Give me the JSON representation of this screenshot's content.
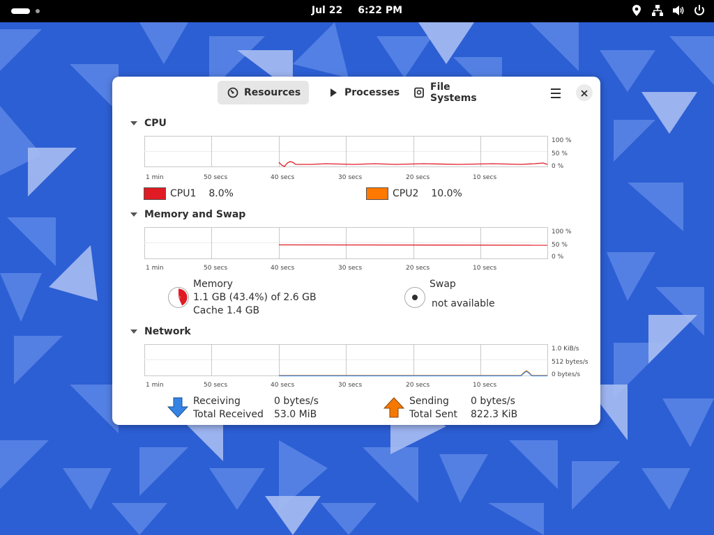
{
  "topbar": {
    "date": "Jul 22",
    "time": "6:22 PM",
    "icons": [
      "location-icon",
      "network-icon",
      "volume-icon",
      "power-icon"
    ]
  },
  "window": {
    "tabs": [
      {
        "label": "Resources",
        "icon": "gauge-icon",
        "active": true
      },
      {
        "label": "Processes",
        "icon": "play-icon",
        "active": false
      },
      {
        "label": "File Systems",
        "icon": "disk-icon",
        "active": false
      }
    ],
    "cpu": {
      "title": "CPU",
      "x_labels": [
        "1 min",
        "50 secs",
        "40 secs",
        "30 secs",
        "20 secs",
        "10 secs"
      ],
      "y_labels": [
        "100 %",
        "50 %",
        "0 %"
      ],
      "cpus": [
        {
          "name": "CPU1",
          "value": "8.0%",
          "color": "#e01b24"
        },
        {
          "name": "CPU2",
          "value": "10.0%",
          "color": "#ff7800"
        }
      ]
    },
    "memory": {
      "title": "Memory and Swap",
      "x_labels": [
        "1 min",
        "50 secs",
        "40 secs",
        "30 secs",
        "20 secs",
        "10 secs"
      ],
      "y_labels": [
        "100 %",
        "50 %",
        "0 %"
      ],
      "memory_label": "Memory",
      "memory_value": "1.1 GB (43.4%) of 2.6 GB",
      "cache_value": "Cache 1.4 GB",
      "memory_fraction": 0.434,
      "memory_color": "#e01b24",
      "swap_label": "Swap",
      "swap_value": "not available"
    },
    "network": {
      "title": "Network",
      "x_labels": [
        "1 min",
        "50 secs",
        "40 secs",
        "30 secs",
        "20 secs",
        "10 secs"
      ],
      "y_labels": [
        "1.0 KiB/s",
        "512 bytes/s",
        "0 bytes/s"
      ],
      "receiving_label": "Receiving",
      "receiving_value": "0 bytes/s",
      "total_received_label": "Total Received",
      "total_received_value": "53.0 MiB",
      "sending_label": "Sending",
      "sending_value": "0 bytes/s",
      "total_sent_label": "Total Sent",
      "total_sent_value": "822.3 KiB",
      "receive_color": "#3584e4",
      "send_color": "#f57900"
    }
  }
}
